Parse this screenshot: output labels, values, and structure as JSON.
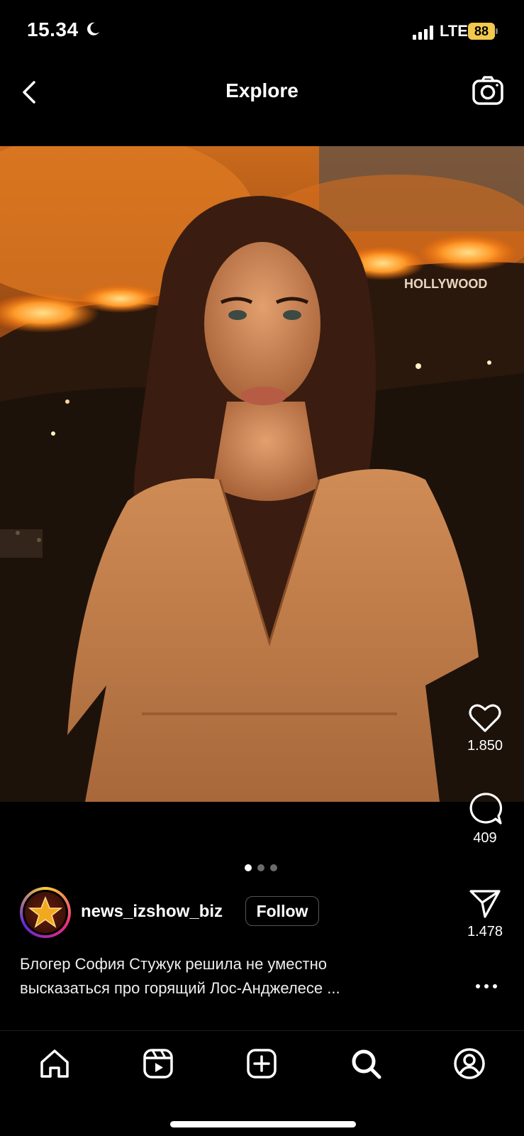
{
  "status_bar": {
    "time": "15.34",
    "network": "LTE",
    "battery": "88"
  },
  "header": {
    "title": "Explore"
  },
  "post": {
    "username": "news_izshow_biz",
    "follow_label": "Follow",
    "caption_line1": "Блогер София Стужук решила не уместно",
    "caption_line2": "высказаться про горящий Лос-Анджелесе ...",
    "photo_sign_text": "HOLLYWOOD",
    "carousel": {
      "count": 3,
      "active_index": 0
    },
    "actions": {
      "likes": "1.850",
      "comments": "409",
      "shares": "1.478"
    }
  },
  "tab_bar": [
    "home-icon",
    "reels-icon",
    "create-icon",
    "search-icon",
    "profile-icon"
  ],
  "colors": {
    "battery": "#f2c94c",
    "background": "#000000",
    "avatar_ring": "#ee2a7b"
  }
}
